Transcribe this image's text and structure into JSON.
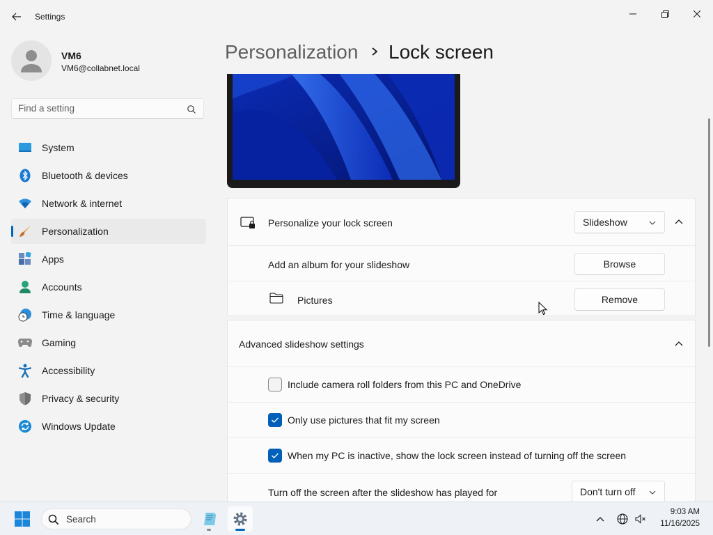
{
  "window": {
    "title": "Settings"
  },
  "user": {
    "name": "VM6",
    "email": "VM6@collabnet.local"
  },
  "search": {
    "placeholder": "Find a setting"
  },
  "nav": {
    "items": [
      {
        "label": "System",
        "icon": "system-icon"
      },
      {
        "label": "Bluetooth & devices",
        "icon": "bluetooth-icon"
      },
      {
        "label": "Network & internet",
        "icon": "wifi-icon"
      },
      {
        "label": "Personalization",
        "icon": "brush-icon",
        "selected": true
      },
      {
        "label": "Apps",
        "icon": "apps-icon"
      },
      {
        "label": "Accounts",
        "icon": "accounts-icon"
      },
      {
        "label": "Time & language",
        "icon": "clock-globe-icon"
      },
      {
        "label": "Gaming",
        "icon": "gamepad-icon"
      },
      {
        "label": "Accessibility",
        "icon": "accessibility-icon"
      },
      {
        "label": "Privacy & security",
        "icon": "shield-icon"
      },
      {
        "label": "Windows Update",
        "icon": "update-icon"
      }
    ]
  },
  "header": {
    "parent": "Personalization",
    "current": "Lock screen"
  },
  "lock_screen": {
    "personalize_label": "Personalize your lock screen",
    "personalize_value": "Slideshow",
    "add_album_label": "Add an album for your slideshow",
    "browse_label": "Browse",
    "album_name": "Pictures",
    "remove_label": "Remove"
  },
  "advanced": {
    "title": "Advanced slideshow settings",
    "options": [
      {
        "label": "Include camera roll folders from this PC and OneDrive",
        "checked": false
      },
      {
        "label": "Only use pictures that fit my screen",
        "checked": true
      },
      {
        "label": "When my PC is inactive, show the lock screen instead of turning off the screen",
        "checked": true
      }
    ],
    "turn_off_label": "Turn off the screen after the slideshow has played for",
    "turn_off_value": "Don't turn off"
  },
  "taskbar": {
    "search_label": "Search",
    "time": "9:03 AM",
    "date": "11/16/2025"
  },
  "colors": {
    "accent": "#0067c0",
    "checkbox_on": "#005fb8",
    "background": "#f3f3f3",
    "card": "#fbfbfb"
  }
}
